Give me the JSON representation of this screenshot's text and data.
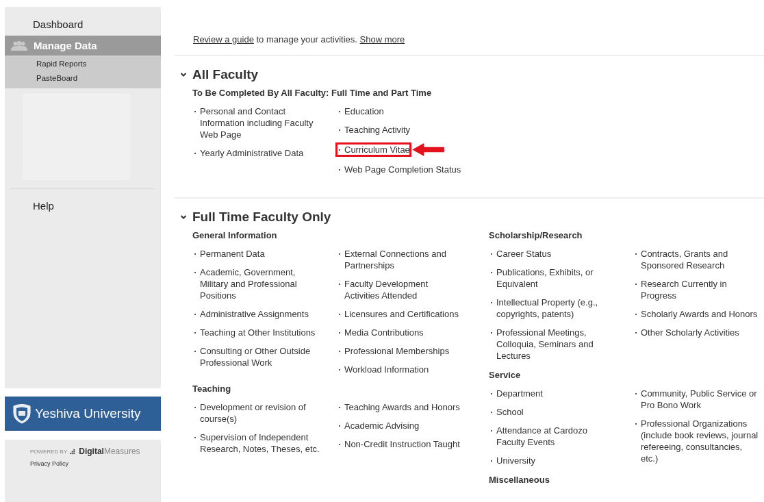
{
  "sidebar": {
    "items": [
      {
        "label": "Dashboard",
        "selected": false
      },
      {
        "label": "Manage Data",
        "selected": true,
        "children": [
          {
            "label": "Rapid Reports"
          },
          {
            "label": "PasteBoard"
          }
        ]
      }
    ],
    "help": "Help",
    "logo_text": "Yeshiva University",
    "powered_by": "POWERED BY",
    "brand_bold": "Digital",
    "brand_light": "Measures",
    "privacy": "Privacy Policy"
  },
  "intro": {
    "link": "Review a guide",
    "text": " to manage your activities. ",
    "more": "Show more"
  },
  "sections": [
    {
      "title": "All Faculty",
      "expanded": true,
      "panes": [
        [
          {
            "heading": "To Be Completed By All Faculty: Full Time and Part Time",
            "columns": [
              [
                {
                  "label": "Personal and Contact Information including Faculty Web Page",
                  "highlighted": false
                },
                {
                  "label": "Yearly Administrative Data",
                  "highlighted": false
                }
              ],
              [
                {
                  "label": "Education",
                  "highlighted": false
                },
                {
                  "label": "Teaching Activity",
                  "highlighted": false
                },
                {
                  "label": "Curriculum Vitae",
                  "highlighted": true
                },
                {
                  "label": "Web Page Completion Status",
                  "highlighted": false
                }
              ]
            ]
          }
        ]
      ]
    },
    {
      "title": "Full Time Faculty Only",
      "expanded": true,
      "panes": [
        [
          {
            "heading": "General Information",
            "columns": [
              [
                {
                  "label": "Permanent Data",
                  "highlighted": false
                },
                {
                  "label": "Academic, Government, Military and Professional Positions",
                  "highlighted": false
                },
                {
                  "label": "Administrative Assignments",
                  "highlighted": false
                },
                {
                  "label": "Teaching at Other Institutions",
                  "highlighted": false
                },
                {
                  "label": "Consulting or Other Outside Professional Work",
                  "highlighted": false
                }
              ],
              [
                {
                  "label": "External Connections and Partnerships",
                  "highlighted": false
                },
                {
                  "label": "Faculty Development Activities Attended",
                  "highlighted": false
                },
                {
                  "label": "Licensures and Certifications",
                  "highlighted": false
                },
                {
                  "label": "Media Contributions",
                  "highlighted": false
                },
                {
                  "label": "Professional Memberships",
                  "highlighted": false
                },
                {
                  "label": "Workload Information",
                  "highlighted": false
                }
              ]
            ]
          },
          {
            "heading": "Teaching",
            "columns": [
              [
                {
                  "label": "Development or revision of course(s)",
                  "highlighted": false
                },
                {
                  "label": "Supervision of Independent Research, Notes, Theses, etc.",
                  "highlighted": false
                }
              ],
              [
                {
                  "label": "Teaching Awards and Honors",
                  "highlighted": false
                },
                {
                  "label": "Academic Advising",
                  "highlighted": false
                },
                {
                  "label": "Non-Credit Instruction Taught",
                  "highlighted": false
                }
              ]
            ]
          }
        ],
        [
          {
            "heading": "Scholarship/Research",
            "columns": [
              [
                {
                  "label": "Career Status",
                  "highlighted": false
                },
                {
                  "label": "Publications, Exhibits, or Equivalent",
                  "highlighted": false
                },
                {
                  "label": "Intellectual Property (e.g., copyrights, patents)",
                  "highlighted": false
                },
                {
                  "label": "Professional Meetings, Colloquia, Seminars and Lectures",
                  "highlighted": false
                }
              ],
              [
                {
                  "label": "Contracts, Grants and Sponsored Research",
                  "highlighted": false
                },
                {
                  "label": "Research Currently in Progress",
                  "highlighted": false
                },
                {
                  "label": "Scholarly Awards and Honors",
                  "highlighted": false
                },
                {
                  "label": "Other Scholarly Activities",
                  "highlighted": false
                }
              ]
            ]
          },
          {
            "heading": "Service",
            "columns": [
              [
                {
                  "label": "Department",
                  "highlighted": false
                },
                {
                  "label": "School",
                  "highlighted": false
                },
                {
                  "label": "Attendance at Cardozo Faculty Events",
                  "highlighted": false
                },
                {
                  "label": "University",
                  "highlighted": false
                }
              ],
              [
                {
                  "label": "Community, Public Service or Pro Bono Work",
                  "highlighted": false
                },
                {
                  "label": "Professional Organizations (include book reviews, journal refereeing, consultancies, etc.)",
                  "highlighted": false
                }
              ]
            ]
          },
          {
            "heading": "Miscellaneous"
          }
        ]
      ]
    }
  ]
}
